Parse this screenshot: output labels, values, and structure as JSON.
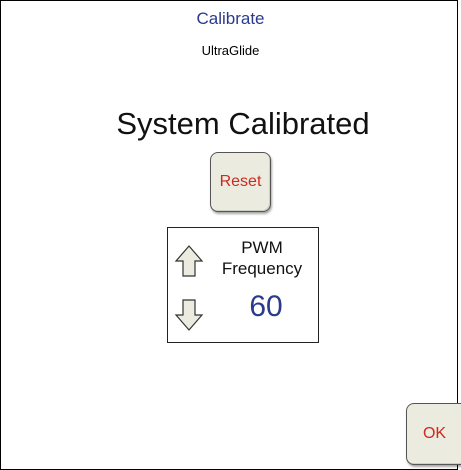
{
  "header": {
    "title": "Calibrate",
    "subtitle": "UltraGlide"
  },
  "status": {
    "text": "System Calibrated"
  },
  "reset_button": {
    "label": "Reset"
  },
  "pwm": {
    "label_line1": "PWM",
    "label_line2": "Frequency",
    "value": "60",
    "up_icon": "arrow-up-icon",
    "down_icon": "arrow-down-icon"
  },
  "ok_button": {
    "label": "OK"
  },
  "colors": {
    "title": "#2a3a8c",
    "value": "#2a3a8c",
    "button_text": "#d0281e",
    "button_fill": "#ebebdf"
  }
}
